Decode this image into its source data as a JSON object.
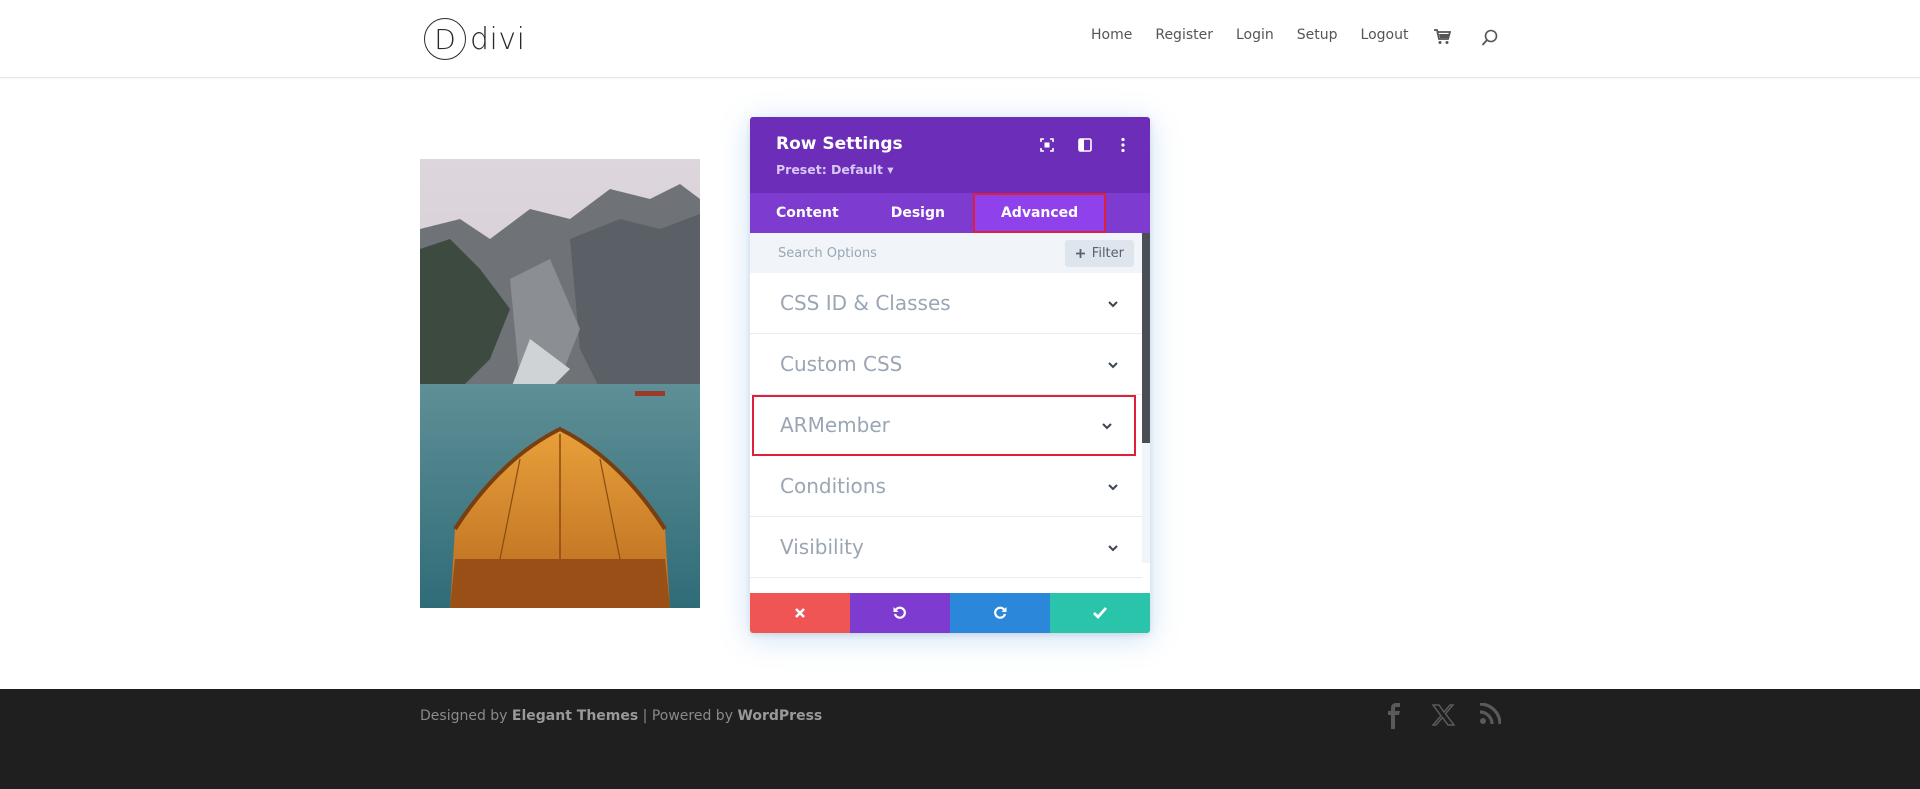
{
  "header": {
    "logo_letter": "D",
    "logo_text": "divi",
    "nav": [
      "Home",
      "Register",
      "Login",
      "Setup",
      "Logout"
    ]
  },
  "modal": {
    "title": "Row Settings",
    "preset": "Preset: Default ▾",
    "tabs": [
      "Content",
      "Design",
      "Advanced"
    ],
    "active_tab": "Advanced",
    "search_placeholder": "Search Options",
    "filter_label": "Filter",
    "sections": [
      "CSS ID & Classes",
      "Custom CSS",
      "ARMember",
      "Conditions",
      "Visibility"
    ],
    "highlighted_section": "ARMember"
  },
  "footer": {
    "designed_by": "Designed by ",
    "elegant": "Elegant Themes",
    "powered_by": " | Powered by ",
    "wordpress": "WordPress"
  },
  "colors": {
    "purple_header": "#6c2eb9",
    "purple_tabs": "#7d3bcf",
    "highlight_red": "#e0203b",
    "cancel": "#ef5555",
    "undo": "#7e3bd0",
    "redo": "#2b87da",
    "save": "#29c4a9"
  }
}
